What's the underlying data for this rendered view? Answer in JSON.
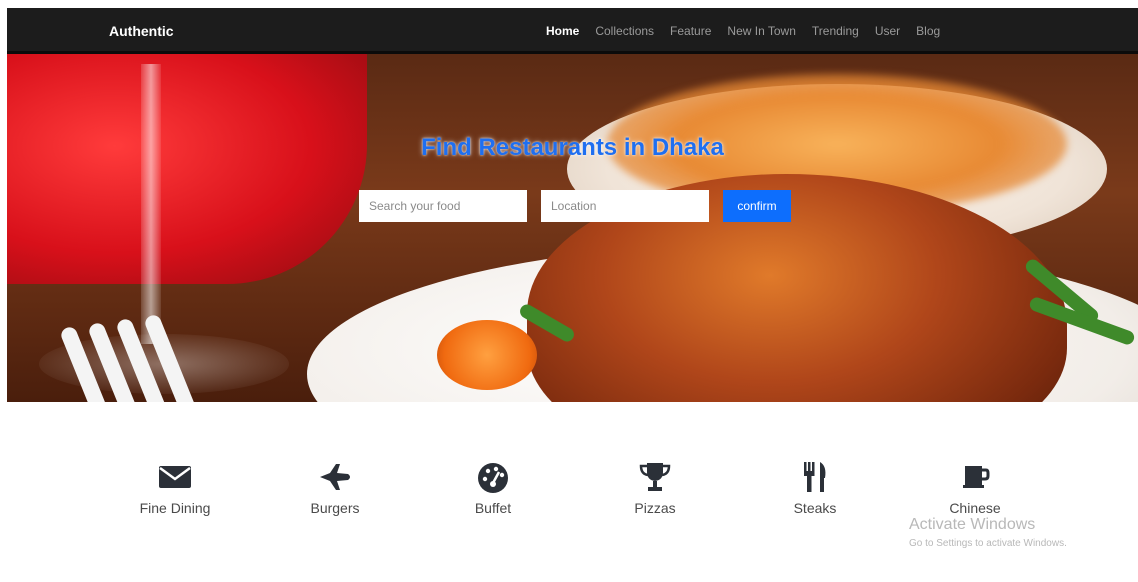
{
  "navbar": {
    "brand": "Authentic",
    "links": [
      "Home",
      "Collections",
      "Feature",
      "New In Town",
      "Trending",
      "User",
      "Blog"
    ],
    "active": "Home"
  },
  "hero": {
    "title": "Find Restaurants in Dhaka",
    "search_placeholder": "Search your food",
    "location_placeholder": "Location",
    "confirm_label": "confirm"
  },
  "categories": [
    {
      "label": "Fine Dining",
      "icon": "envelope-icon"
    },
    {
      "label": "Burgers",
      "icon": "plane-icon"
    },
    {
      "label": "Buffet",
      "icon": "dashboard-icon"
    },
    {
      "label": "Pizzas",
      "icon": "trophy-icon"
    },
    {
      "label": "Steaks",
      "icon": "utensils-icon"
    },
    {
      "label": "Chinese",
      "icon": "mug-icon"
    }
  ],
  "watermark": {
    "line1": "Activate Windows",
    "line2": "Go to Settings to activate Windows."
  },
  "colors": {
    "navbar_bg": "#1c1c1c",
    "accent": "#0d6efd",
    "title": "#1f6ff0",
    "icon": "#2b3038"
  }
}
